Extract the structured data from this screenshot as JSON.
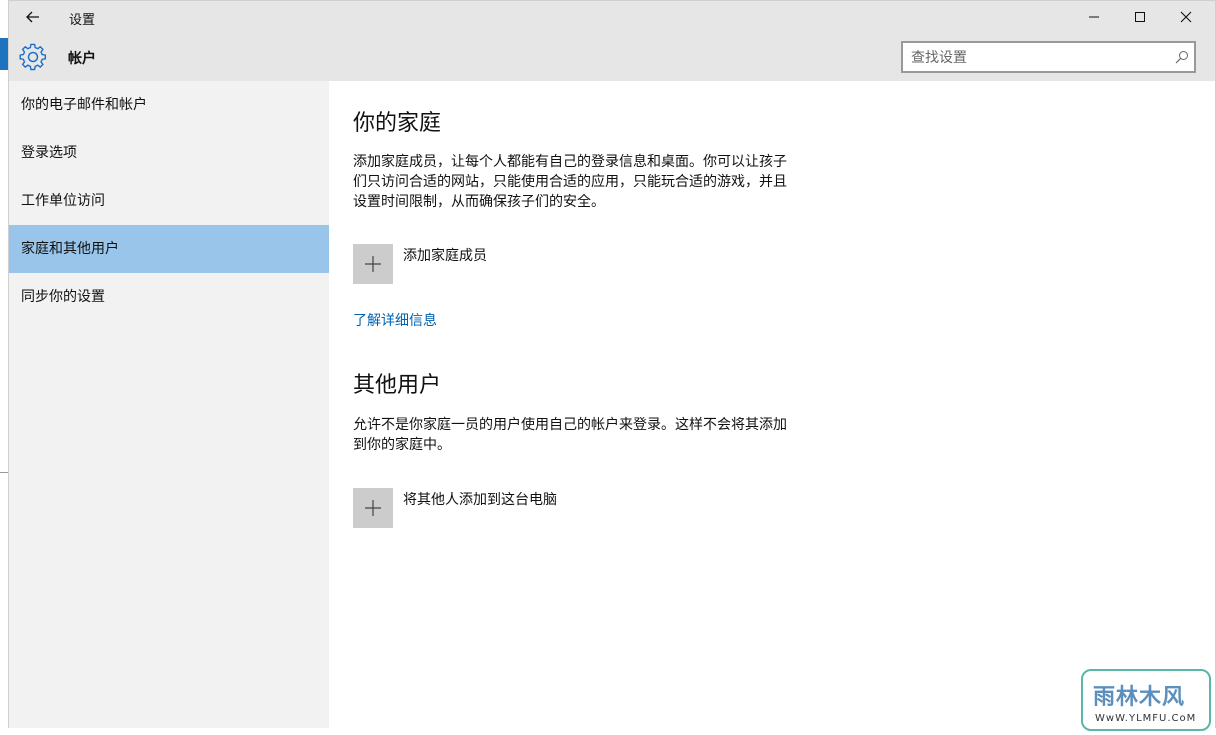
{
  "window": {
    "title": "设置",
    "back_icon": "arrow-left-icon",
    "minimize_icon": "minimize-icon",
    "maximize_icon": "maximize-icon",
    "close_icon": "close-icon"
  },
  "header": {
    "title": "帐户",
    "icon": "gear-icon",
    "search_placeholder": "查找设置",
    "search_icon": "search-icon"
  },
  "sidebar": {
    "items": [
      {
        "label": "你的电子邮件和帐户",
        "selected": false
      },
      {
        "label": "登录选项",
        "selected": false
      },
      {
        "label": "工作单位访问",
        "selected": false
      },
      {
        "label": "家庭和其他用户",
        "selected": true
      },
      {
        "label": "同步你的设置",
        "selected": false
      }
    ]
  },
  "main": {
    "family": {
      "title": "你的家庭",
      "description": "添加家庭成员，让每个人都能有自己的登录信息和桌面。你可以让孩子们只访问合适的网站，只能使用合适的应用，只能玩合适的游戏，并且设置时间限制，从而确保孩子们的安全。",
      "add_label": "添加家庭成员",
      "link": "了解详细信息"
    },
    "others": {
      "title": "其他用户",
      "description": "允许不是你家庭一员的用户使用自己的帐户来登录。这样不会将其添加到你的家庭中。",
      "add_label": "将其他人添加到这台电脑"
    }
  },
  "colors": {
    "accent_selected": "#99c5ea",
    "link": "#0063b1",
    "header_bg": "#e6e6e6",
    "sidebar_bg": "#f2f2f2"
  },
  "watermark": {
    "main": "雨林木风",
    "sub": "WwW.YLMFU.CoM"
  }
}
